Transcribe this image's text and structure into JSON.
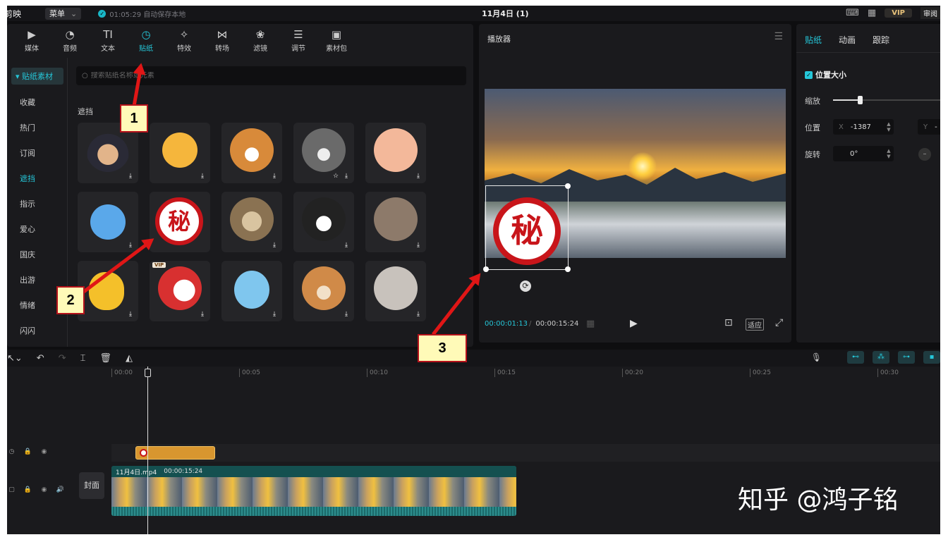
{
  "titlebar": {
    "app": "剪映",
    "menu_label": "菜单",
    "save_status": "01:05:29 自动保存本地",
    "project_title": "11月4日 (1)",
    "vip": "VIP",
    "review": "审阅"
  },
  "tools": [
    {
      "label": "媒体",
      "icon": "media-icon"
    },
    {
      "label": "音频",
      "icon": "audio-icon"
    },
    {
      "label": "文本",
      "icon": "text-icon"
    },
    {
      "label": "贴纸",
      "icon": "sticker-icon",
      "active": true
    },
    {
      "label": "特效",
      "icon": "effects-icon"
    },
    {
      "label": "转场",
      "icon": "transition-icon"
    },
    {
      "label": "滤镜",
      "icon": "filter-icon"
    },
    {
      "label": "调节",
      "icon": "adjust-icon"
    },
    {
      "label": "素材包",
      "icon": "package-icon"
    }
  ],
  "categories": {
    "head": "贴纸素材",
    "items": [
      "收藏",
      "热门",
      "订阅",
      "遮挡",
      "指示",
      "爱心",
      "国庆",
      "出游",
      "情绪",
      "闪闪"
    ],
    "active": "遮挡"
  },
  "search": {
    "placeholder": "搜索贴纸名称或元素"
  },
  "section_label": "遮挡",
  "stickers": {
    "secret_char": "秘",
    "vip_tag": "VIP"
  },
  "player": {
    "title": "播放器",
    "current_time": "00:00:01:13",
    "total_time": "00:00:15:24",
    "fit": "适应"
  },
  "props": {
    "tabs": [
      "贴纸",
      "动画",
      "跟踪"
    ],
    "active_tab": "贴纸",
    "pos_size": "位置大小",
    "scale_label": "缩放",
    "position_label": "位置",
    "rotate_label": "旋转",
    "x_axis": "X",
    "x_value": "-1387",
    "y_axis": "Y",
    "y_value": "-",
    "rotate_value": "0°"
  },
  "timeline": {
    "ticks": [
      "00:00",
      "00:05",
      "00:10",
      "00:15",
      "00:20",
      "00:25",
      "00:30"
    ],
    "cover": "封面",
    "clip_name": "11月4日.mp4",
    "clip_duration": "00:00:15:24"
  },
  "annotations": [
    "1",
    "2",
    "3"
  ],
  "watermark": "知乎 @鸿子铭"
}
